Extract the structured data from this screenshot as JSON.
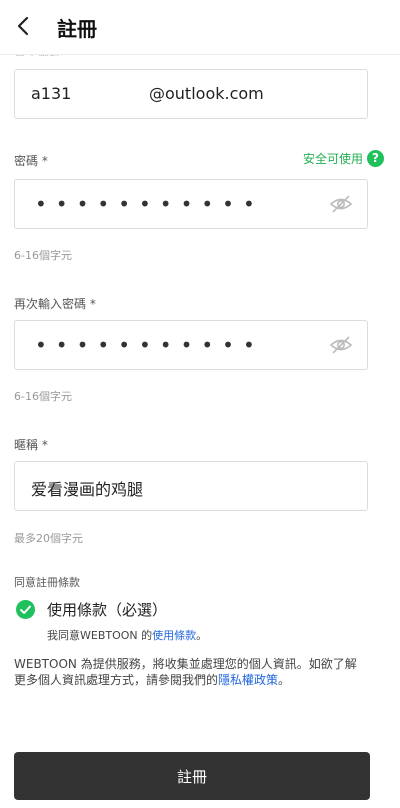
{
  "header": {
    "title": "註冊"
  },
  "email": {
    "value_start": "a131",
    "value_end": "@outlook.com"
  },
  "password": {
    "label": "密碼 *",
    "status": "安全可使用",
    "status_icon": "?",
    "masked": "•••••••••••",
    "hint": "6-16個字元"
  },
  "confirm_password": {
    "label": "再次輸入密碼 *",
    "masked": "•••••••••••",
    "hint": "6-16個字元"
  },
  "nickname": {
    "label": "暱稱 *",
    "value": "爱看漫画的鸡腿",
    "hint": "最多20個字元"
  },
  "terms": {
    "section_title": "同意註冊條款",
    "item_label": "使用條款（必選）",
    "item_sub_prefix": "我同意WEBTOON 的",
    "item_sub_link": "使用條款",
    "item_sub_suffix": "。",
    "checked": true
  },
  "privacy": {
    "text": "WEBTOON 為提供服務，將收集並處理您的個人資訊。如欲了解更多個人資訊處理方式，請參閱我們的",
    "link": "隱私權政策",
    "suffix": "。"
  },
  "submit_label": "註冊",
  "colors": {
    "accent_green": "#20c05c",
    "link_blue": "#2266dd",
    "button_dark": "#333333"
  }
}
